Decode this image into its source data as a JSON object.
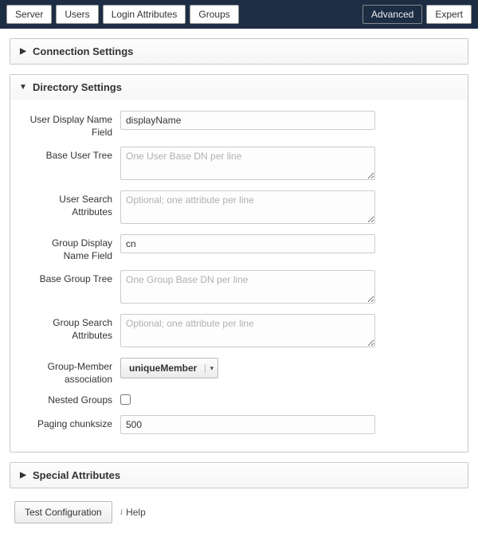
{
  "tabs": {
    "server": "Server",
    "users": "Users",
    "login_attributes": "Login Attributes",
    "groups": "Groups",
    "advanced": "Advanced",
    "expert": "Expert"
  },
  "panels": {
    "connection": "Connection Settings",
    "directory": "Directory Settings",
    "special": "Special Attributes"
  },
  "form": {
    "user_display_name_label": "User Display Name Field",
    "user_display_name_value": "displayName",
    "base_user_tree_label": "Base User Tree",
    "base_user_tree_placeholder": "One User Base DN per line",
    "user_search_attr_label": "User Search Attributes",
    "user_search_attr_placeholder": "Optional; one attribute per line",
    "group_display_name_label": "Group Display Name Field",
    "group_display_name_value": "cn",
    "base_group_tree_label": "Base Group Tree",
    "base_group_tree_placeholder": "One Group Base DN per line",
    "group_search_attr_label": "Group Search Attributes",
    "group_search_attr_placeholder": "Optional; one attribute per line",
    "group_member_assoc_label": "Group-Member association",
    "group_member_assoc_value": "uniqueMember",
    "nested_groups_label": "Nested Groups",
    "nested_groups_checked": false,
    "paging_chunksize_label": "Paging chunksize",
    "paging_chunksize_value": "500"
  },
  "footer": {
    "test_config": "Test Configuration",
    "help": "Help"
  }
}
